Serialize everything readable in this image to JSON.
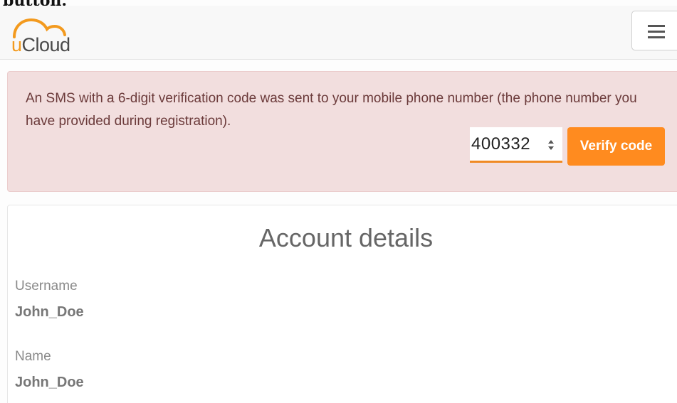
{
  "top_clip_text": "button.",
  "brand": {
    "logo_prefix": "u",
    "logo_suffix": "Cloud",
    "accent_color": "#f39a1e"
  },
  "navbar": {
    "menu_icon": "hamburger-menu-icon"
  },
  "alert": {
    "message": "An SMS with a 6-digit verification code was sent to your mobile phone number (the phone number you have provided during registration).",
    "code_value": "400332",
    "verify_label": "Verify code",
    "button_color": "#ff8b1f",
    "background_color": "#f2dede"
  },
  "account": {
    "title": "Account details",
    "fields": [
      {
        "label": "Username",
        "value": "John_Doe"
      },
      {
        "label": "Name",
        "value": "John_Doe"
      }
    ]
  }
}
